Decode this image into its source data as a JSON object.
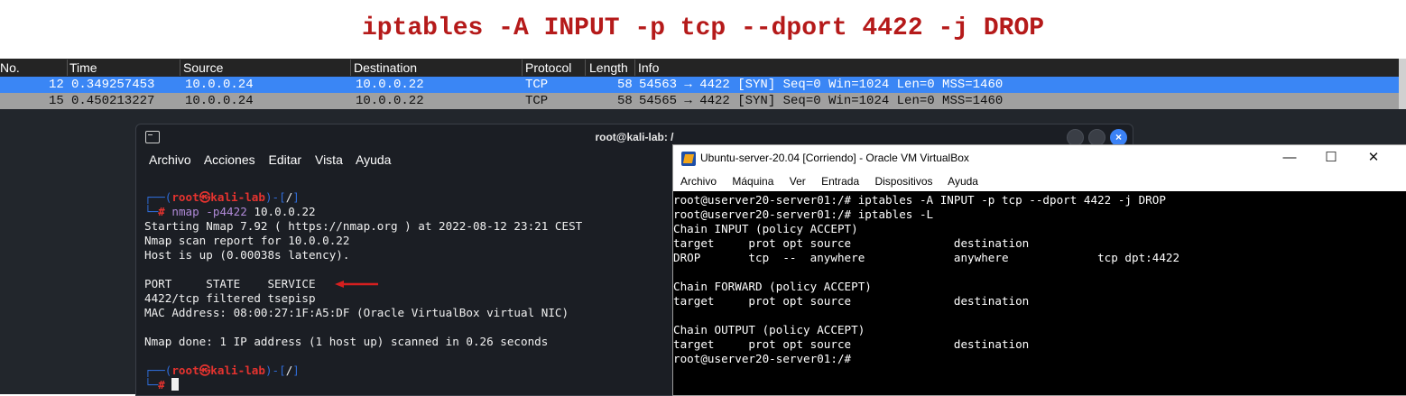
{
  "headline": "iptables -A INPUT -p tcp --dport 4422 -j DROP",
  "wireshark": {
    "columns": [
      "No.",
      "Time",
      "Source",
      "Destination",
      "Protocol",
      "Length",
      "Info"
    ],
    "rows": [
      {
        "no": "12",
        "time": "0.349257453",
        "source": "10.0.0.24",
        "destination": "10.0.0.22",
        "protocol": "TCP",
        "length": "58",
        "info": "54563 → 4422 [SYN] Seq=0 Win=1024 Len=0 MSS=1460"
      },
      {
        "no": "15",
        "time": "0.450213227",
        "source": "10.0.0.24",
        "destination": "10.0.0.22",
        "protocol": "TCP",
        "length": "58",
        "info": "54565 → 4422 [SYN] Seq=0 Win=1024 Len=0 MSS=1460"
      }
    ]
  },
  "kali": {
    "title": "root@kali-lab: /",
    "menu": [
      "Archivo",
      "Acciones",
      "Editar",
      "Vista",
      "Ayuda"
    ],
    "prompt_user": "root",
    "prompt_at": "㉿",
    "prompt_host": "kali-lab",
    "prompt_dir": "/",
    "prompt_hash": "#",
    "command_bin": "nmap",
    "command_flag": "-p4422",
    "command_target": "10.0.0.22",
    "output": [
      "Starting Nmap 7.92 ( https://nmap.org ) at 2022-08-12 23:21 CEST",
      "Nmap scan report for 10.0.0.22",
      "Host is up (0.00038s latency).",
      "",
      "PORT     STATE    SERVICE",
      "4422/tcp filtered tsepisp",
      "MAC Address: 08:00:27:1F:A5:DF (Oracle VirtualBox virtual NIC)",
      "",
      "Nmap done: 1 IP address (1 host up) scanned in 0.26 seconds"
    ]
  },
  "vbox": {
    "title": "Ubuntu-server-20.04 [Corriendo] - Oracle VM VirtualBox",
    "menu": [
      "Archivo",
      "Máquina",
      "Ver",
      "Entrada",
      "Dispositivos",
      "Ayuda"
    ],
    "lines": [
      "root@userver20-server01:/# iptables -A INPUT -p tcp --dport 4422 -j DROP",
      "root@userver20-server01:/# iptables -L",
      "Chain INPUT (policy ACCEPT)",
      "target     prot opt source               destination",
      "DROP       tcp  --  anywhere             anywhere             tcp dpt:4422",
      "",
      "Chain FORWARD (policy ACCEPT)",
      "target     prot opt source               destination",
      "",
      "Chain OUTPUT (policy ACCEPT)",
      "target     prot opt source               destination",
      "root@userver20-server01:/#"
    ]
  },
  "colors": {
    "headline": "#b51a1a",
    "selected_row": "#3a86f5",
    "prompt_red": "#e5332f",
    "prompt_blue": "#2f6bd6"
  }
}
